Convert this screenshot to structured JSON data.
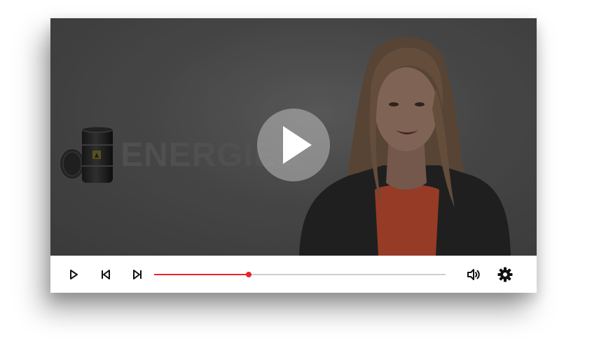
{
  "video": {
    "background_text": "ENERGIES",
    "state": "paused"
  },
  "controls": {
    "play_icon": "play-icon",
    "prev_icon": "skip-previous-icon",
    "next_icon": "skip-next-icon",
    "volume_icon": "volume-icon",
    "settings_icon": "settings-gear-icon",
    "progress_fraction": 0.325
  },
  "colors": {
    "progress": "#e8262b",
    "track": "#cfcfcf",
    "controls_bg": "#ffffff",
    "icon": "#111111"
  }
}
